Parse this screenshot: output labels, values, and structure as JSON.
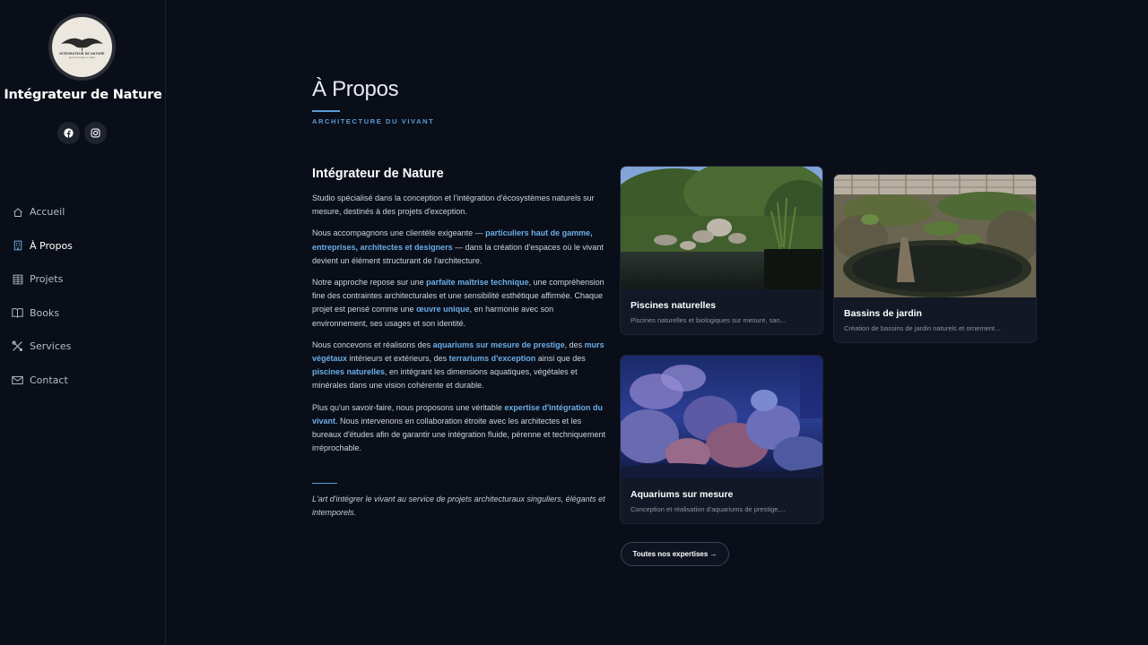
{
  "sidebar": {
    "logo_text": "INTÉGRATEUR DE NATURE",
    "logo_sub": "ARCHITECTURE DU VIVANT",
    "site_title": "Intégrateur de Nature",
    "social": [
      {
        "icon": "facebook-icon"
      },
      {
        "icon": "instagram-icon"
      }
    ],
    "nav": [
      {
        "label": "Accueil",
        "icon": "home-icon"
      },
      {
        "label": "À Propos",
        "icon": "building-icon",
        "active": true
      },
      {
        "label": "Projets",
        "icon": "grid-icon"
      },
      {
        "label": "Books",
        "icon": "book-icon"
      },
      {
        "label": "Services",
        "icon": "tools-icon"
      },
      {
        "label": "Contact",
        "icon": "envelope-icon"
      }
    ]
  },
  "page": {
    "title": "À Propos",
    "subtitle": "ARCHITECTURE DU VIVANT",
    "section_title": "Intégrateur de Nature",
    "paragraphs": {
      "p1": "Studio spécialisé dans la conception et l'intégration d'écosystèmes naturels sur mesure, destinés à des projets d'exception.",
      "p2a": "Nous accompagnons une clientèle exigeante — ",
      "p2b": "particuliers haut de gamme, entreprises, architectes et designers",
      "p2c": " — dans la création d'espaces où le vivant devient un élément structurant de l'architecture.",
      "p3a": "Notre approche repose sur une ",
      "p3b": "parfaite maîtrise technique",
      "p3c": ", une compréhension fine des contraintes architecturales et une sensibilité esthétique affirmée. Chaque projet est pensé comme une ",
      "p3d": "œuvre unique",
      "p3e": ", en harmonie avec son environnement, ses usages et son identité.",
      "p4a": "Nous concevons et réalisons des ",
      "p4b": "aquariums sur mesure de prestige",
      "p4c": ", des ",
      "p4d": "murs végétaux",
      "p4e": " intérieurs et extérieurs, des ",
      "p4f": "terrariums d'exception",
      "p4g": " ainsi que des ",
      "p4h": "piscines naturelles",
      "p4i": ", en intégrant les dimensions aquatiques, végétales et minérales dans une vision cohérente et durable.",
      "p5a": "Plus qu'un savoir-faire, nous proposons une véritable ",
      "p5b": "expertise d'intégration du vivant",
      "p5c": ". Nous intervenons en collaboration étroite avec les architectes et les bureaux d'études afin de garantir une intégration fluide, pérenne et techniquement irréprochable."
    },
    "quote": "L'art d'intégrer le vivant au service de projets architecturaux singuliers, élégants et intemporels."
  },
  "cards": [
    {
      "title": "Piscines naturelles",
      "desc": "Piscines naturelles et biologiques sur mesure, san..."
    },
    {
      "title": "Bassins de jardin",
      "desc": "Création de bassins de jardin naturels et ornement..."
    },
    {
      "title": "Aquariums sur mesure",
      "desc": "Conception et réalisation d'aquariums de prestige,..."
    }
  ],
  "cta": {
    "label": "Toutes nos expertises →"
  },
  "colors": {
    "accent": "#5b9bd5",
    "link": "#6aaee8",
    "background": "#0a0e18",
    "card": "#121826"
  }
}
